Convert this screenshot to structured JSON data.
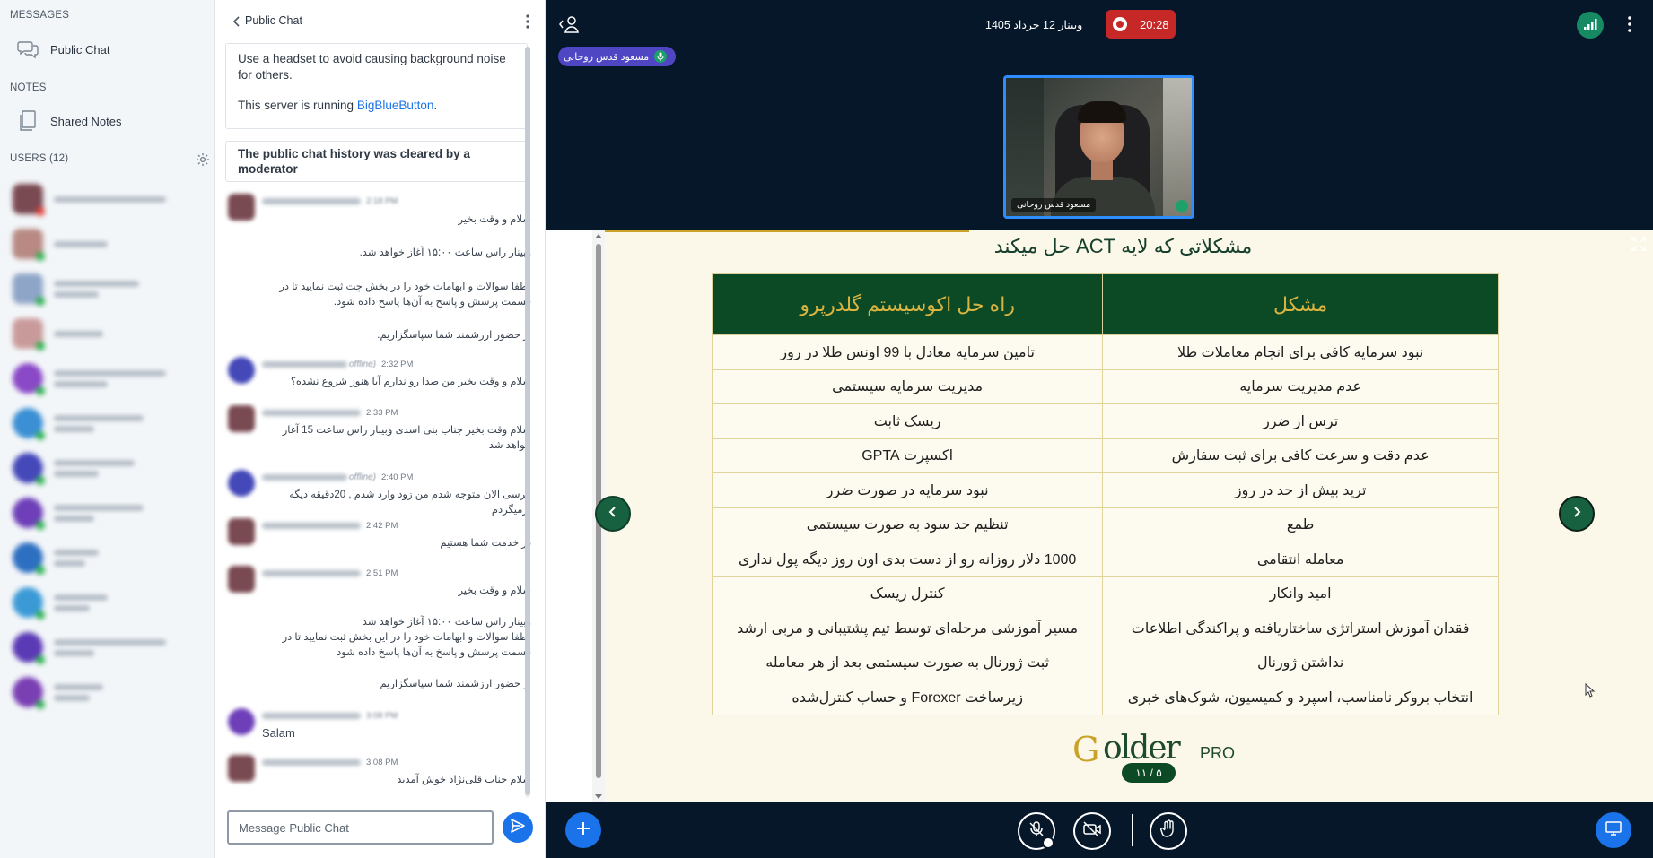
{
  "sidebar": {
    "messages_title": "MESSAGES",
    "public_chat_label": "Public Chat",
    "notes_title": "NOTES",
    "shared_notes_label": "Shared Notes",
    "users_title": "USERS (12)"
  },
  "chat": {
    "header_title": "Public Chat",
    "welcome_line1": "Use a headset to avoid causing background noise for others.",
    "welcome_line2_prefix": "This server is running ",
    "welcome_link": "BigBlueButton",
    "welcome_line2_suffix": ".",
    "cleared_notice": "The public chat history was cleared by a moderator",
    "messages": [
      {
        "time": "",
        "offline": "",
        "text": "سلام و وقت بخیر"
      },
      {
        "time": "",
        "offline": "",
        "text": "وبینار راس ساعت ۱۵:۰۰ آغاز خواهد شد."
      },
      {
        "time": "",
        "offline": "",
        "text": "لطفا سوالات و ابهامات خود را در بخش چت ثبت نمایید تا در قسمت پرسش و پاسخ به آن‌ها پاسخ داده شود."
      },
      {
        "time": "",
        "offline": "",
        "text": "از حضور ارزشمند شما سپاسگزاریم."
      },
      {
        "time": "2:32 PM",
        "offline": "offline)",
        "text": "سلام و وقت بخیر من صدا رو ندارم آیا هنوز شروع نشده؟"
      },
      {
        "time": "2:33 PM",
        "offline": "",
        "text": "سلام وقت بخیر جناب بنی اسدی وبینار راس ساعت 15 آغاز خواهد شد"
      },
      {
        "time": "2:40 PM",
        "offline": "offline)",
        "text": "مرسی الان متوجه شدم من زود وارد شدم , 20دقیقه دیگه برمیگردم"
      },
      {
        "time": "2:42 PM",
        "offline": "",
        "text": "در خدمت شما هستیم"
      },
      {
        "time": "2:51 PM",
        "offline": "",
        "text": "سلام و وقت بخیر"
      },
      {
        "time": "",
        "offline": "",
        "text": "وبینار راس ساعت ۱۵:۰۰ آغاز خواهد شد\nلطفا سوالات و ابهامات خود را در این بخش ثبت نمایید تا در قسمت پرسش و پاسخ به آن‌ها پاسخ داده شود"
      },
      {
        "time": "",
        "offline": "",
        "text": "از حضور ارزشمند شما سپاسگزاریم"
      },
      {
        "time": "",
        "offline": "",
        "text": "Salam"
      },
      {
        "time": "3:08 PM",
        "offline": "",
        "text": "سلام جناب قلی‌نژاد خوش آمدید"
      }
    ],
    "input_placeholder": "Message Public Chat"
  },
  "session": {
    "title": "وبینار 12 خرداد 1405",
    "recording_time": "20:28",
    "talker_name": "مسعود قدس روحانی",
    "webcam_name": "مسعود قدس روحانی"
  },
  "slide": {
    "title": "مشکلاتی که لایه ACT حل میکند",
    "col_problem": "مشکل",
    "col_solution": "راه حل اکوسیستم گلدرپرو",
    "rows": [
      {
        "problem": "نبود سرمایه کافی برای انجام معاملات طلا",
        "solution": "تامین سرمایه معادل با 99 اونس طلا در روز"
      },
      {
        "problem": "عدم مدیریت سرمایه",
        "solution": "مدیریت سرمایه سیستمی"
      },
      {
        "problem": "ترس از ضرر",
        "solution": "ریسک ثابت"
      },
      {
        "problem": "عدم دقت و سرعت کافی برای ثبت سفارش",
        "solution": "اکسپرت GPTA"
      },
      {
        "problem": "ترید بیش از حد در روز",
        "solution": "نبود سرمایه در صورت ضرر"
      },
      {
        "problem": "طمع",
        "solution": "تنظیم حد سود به صورت سیستمی"
      },
      {
        "problem": "معامله انتقامی",
        "solution": "1000 دلار روزانه رو از دست بدی اون روز دیگه پول نداری"
      },
      {
        "problem": "امید وانکار",
        "solution": "کنترل ریسک"
      },
      {
        "problem": "فقدان آموزش استراتژی ساختاریافته و پراکندگی اطلاعات",
        "solution": "مسیر آموزشی مرحله‌ای توسط تیم پشتیبانی و مربی ارشد"
      },
      {
        "problem": "نداشتن ژورنال",
        "solution": "ثبت ژورنال به صورت سیستمی بعد از هر معامله"
      },
      {
        "problem": "انتخاب بروکر نامناسب، اسپرد و کمیسیون، شوک‌های خبری",
        "solution": "زیرساخت Forexer و حساب کنترل‌شده"
      }
    ],
    "logo_g": "G",
    "logo_word": "older",
    "logo_pro": "PRO",
    "page": "۱۱ / ۵"
  },
  "colors": {
    "accent": "#1a73e8",
    "recording": "#c62828",
    "slide_header": "#0c4a25",
    "slide_gold": "#d9b441",
    "talker": "#4f46c4"
  },
  "icons": {
    "public_chat": "chat-bubbles-icon",
    "shared_notes": "notes-icon",
    "users_settings": "gear-icon",
    "back": "chevron-left-icon",
    "options": "kebab-icon",
    "send": "send-icon",
    "user_list": "user-toggle-icon",
    "record": "record-icon",
    "connection": "signal-icon",
    "prev": "chevron-left-icon",
    "next": "chevron-right-icon",
    "fullscreen": "fullscreen-icon",
    "actions": "plus-icon",
    "mic": "mic-muted-icon",
    "camera": "camera-off-icon",
    "hand": "raise-hand-icon",
    "presentation": "presentation-icon"
  }
}
